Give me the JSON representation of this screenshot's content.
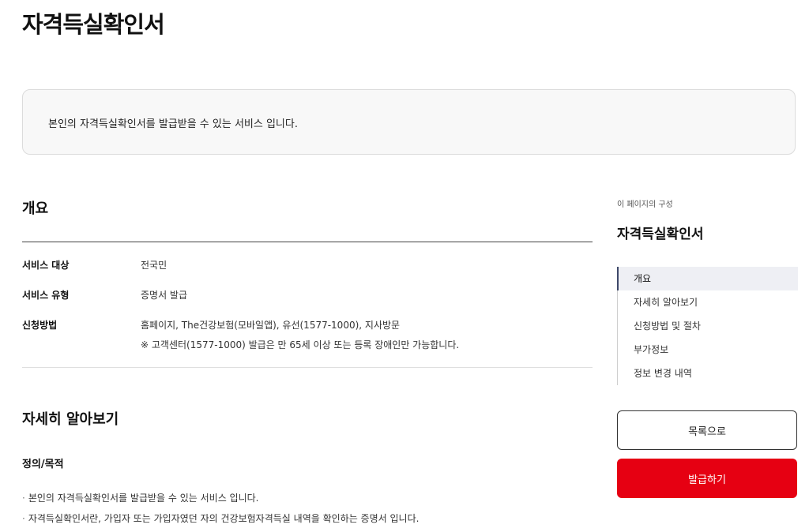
{
  "page": {
    "title": "자격득실확인서"
  },
  "intro": {
    "text": "본인의 자격득실확인서를 발급받을 수 있는 서비스 입니다."
  },
  "overview": {
    "heading": "개요",
    "rows": [
      {
        "label": "서비스 대상",
        "value": "전국민"
      },
      {
        "label": "서비스 유형",
        "value": "증명서 발급"
      },
      {
        "label": "신청방법",
        "value": "홈페이지, The건강보험(모바일앱), 유선(1577-1000), 지사방문",
        "note": "※  고객센터(1577-1000) 발급은 만 65세 이상 또는 등록 장애인만 가능합니다."
      }
    ]
  },
  "details": {
    "heading": "자세히 알아보기",
    "subheading": "정의/목적",
    "bullets": [
      "본인의 자격득실확인서를 발급받을 수 있는 서비스 입니다.",
      "자격득실확인서란, 가입자 또는 가입자였던 자의 건강보험자격득실 내역을 확인하는 증명서 입니다."
    ]
  },
  "sidebar": {
    "caption": "이 페이지의 구성",
    "title": "자격득실확인서",
    "toc": [
      {
        "label": "개요",
        "active": true
      },
      {
        "label": "자세히 알아보기"
      },
      {
        "label": "신청방법 및 절차"
      },
      {
        "label": "부가정보"
      },
      {
        "label": "정보 변경 내역"
      }
    ],
    "list_button": "목록으로",
    "issue_button": "발급하기"
  },
  "colors": {
    "primary": "#e60012",
    "toc_active_bar": "#3d4869"
  }
}
